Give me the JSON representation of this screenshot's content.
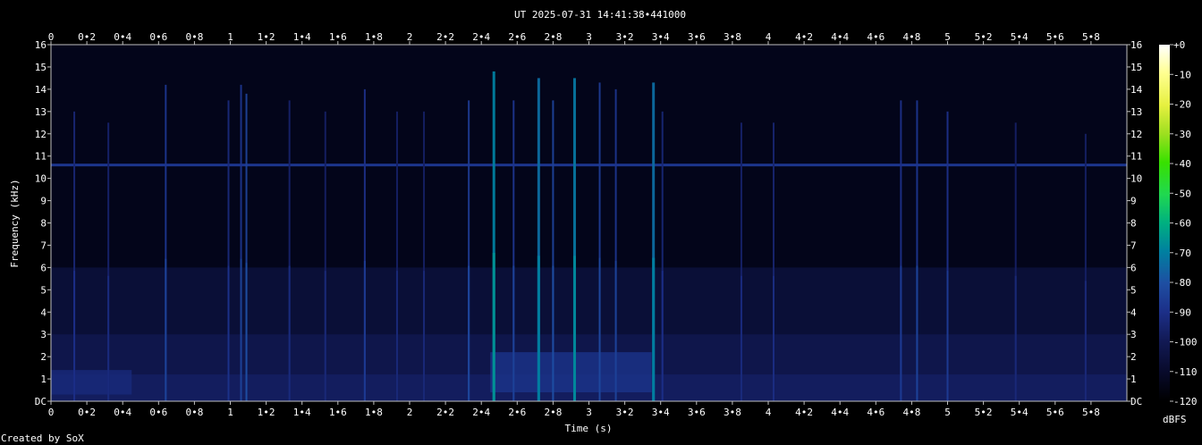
{
  "chart_data": {
    "type": "heatmap",
    "title": "UT 2025-07-31 14:41:38•441000",
    "xlabel": "Time (s)",
    "ylabel": "Frequency (kHz)",
    "xlim": [
      0,
      6
    ],
    "ylim": [
      0,
      16
    ],
    "x_tick_labels": [
      "0",
      "0•2",
      "0•4",
      "0•6",
      "0•8",
      "1",
      "1•2",
      "1•4",
      "1•6",
      "1•8",
      "2",
      "2•2",
      "2•4",
      "2•6",
      "2•8",
      "3",
      "3•2",
      "3•4",
      "3•6",
      "3•8",
      "4",
      "4•2",
      "4•4",
      "4•6",
      "4•8",
      "5",
      "5•2",
      "5•4",
      "5•6",
      "5•8"
    ],
    "x_tick_values": [
      0,
      0.2,
      0.4,
      0.6,
      0.8,
      1,
      1.2,
      1.4,
      1.6,
      1.8,
      2,
      2.2,
      2.4,
      2.6,
      2.8,
      3,
      3.2,
      3.4,
      3.6,
      3.8,
      4,
      4.2,
      4.4,
      4.6,
      4.8,
      5,
      5.2,
      5.4,
      5.6,
      5.8
    ],
    "y_tick_labels": [
      "DC",
      "1",
      "2",
      "3",
      "4",
      "5",
      "6",
      "7",
      "8",
      "9",
      "10",
      "11",
      "12",
      "13",
      "14",
      "15",
      "16"
    ],
    "y_tick_values": [
      0,
      1,
      2,
      3,
      4,
      5,
      6,
      7,
      8,
      9,
      10,
      11,
      12,
      13,
      14,
      15,
      16
    ],
    "colorbar": {
      "label": "dBFS",
      "range": [
        -120,
        0
      ],
      "tick_labels": [
        "+0",
        "-10",
        "-20",
        "-30",
        "-40",
        "-50",
        "-60",
        "-70",
        "-80",
        "-90",
        "-100",
        "-110",
        "-120"
      ],
      "tick_values": [
        0,
        -10,
        -20,
        -30,
        -40,
        -50,
        -60,
        -70,
        -80,
        -90,
        -100,
        -110,
        -120
      ]
    },
    "background_level_dbfs": -100,
    "horizontal_tone": {
      "freq_khz": 10.6,
      "level_dbfs": -88
    },
    "transients": [
      {
        "t": 0.13,
        "fmax": 13.0,
        "level": -94
      },
      {
        "t": 0.32,
        "fmax": 12.5,
        "level": -96
      },
      {
        "t": 0.64,
        "fmax": 14.2,
        "level": -88
      },
      {
        "t": 0.99,
        "fmax": 13.5,
        "level": -93
      },
      {
        "t": 1.06,
        "fmax": 14.2,
        "level": -88
      },
      {
        "t": 1.09,
        "fmax": 13.8,
        "level": -84
      },
      {
        "t": 1.33,
        "fmax": 13.5,
        "level": -96
      },
      {
        "t": 1.53,
        "fmax": 13.0,
        "level": -97
      },
      {
        "t": 1.75,
        "fmax": 14.0,
        "level": -90
      },
      {
        "t": 1.93,
        "fmax": 13.0,
        "level": -97
      },
      {
        "t": 2.08,
        "fmax": 13.0,
        "level": -97
      },
      {
        "t": 2.33,
        "fmax": 13.5,
        "level": -86
      },
      {
        "t": 2.47,
        "fmax": 14.8,
        "level": -70
      },
      {
        "t": 2.58,
        "fmax": 13.5,
        "level": -88
      },
      {
        "t": 2.72,
        "fmax": 14.5,
        "level": -74
      },
      {
        "t": 2.8,
        "fmax": 13.5,
        "level": -84
      },
      {
        "t": 2.92,
        "fmax": 14.5,
        "level": -72
      },
      {
        "t": 3.06,
        "fmax": 14.3,
        "level": -86
      },
      {
        "t": 3.15,
        "fmax": 14.0,
        "level": -88
      },
      {
        "t": 3.36,
        "fmax": 14.3,
        "level": -74
      },
      {
        "t": 3.41,
        "fmax": 13.0,
        "level": -94
      },
      {
        "t": 3.85,
        "fmax": 12.5,
        "level": -96
      },
      {
        "t": 4.03,
        "fmax": 12.5,
        "level": -95
      },
      {
        "t": 4.74,
        "fmax": 13.5,
        "level": -90
      },
      {
        "t": 4.83,
        "fmax": 13.5,
        "level": -88
      },
      {
        "t": 5.0,
        "fmax": 13.0,
        "level": -90
      },
      {
        "t": 5.38,
        "fmax": 12.5,
        "level": -97
      },
      {
        "t": 5.77,
        "fmax": 12.0,
        "level": -97
      }
    ],
    "low_band_energy": [
      {
        "t0": 2.45,
        "t1": 3.35,
        "f0": 0.4,
        "f1": 2.2,
        "level": -88
      },
      {
        "t0": 0.0,
        "t1": 0.45,
        "f0": 0.3,
        "f1": 1.4,
        "level": -92
      }
    ]
  },
  "footer": {
    "credit": "Created by SoX"
  },
  "palette": {
    "stops": [
      "#ffffff",
      "#ffff90",
      "#e6f040",
      "#9ddf20",
      "#38e000",
      "#20d850",
      "#00b080",
      "#0080a0",
      "#1e4ea2",
      "#1c2f88",
      "#121a55",
      "#080a2a",
      "#000000"
    ]
  }
}
